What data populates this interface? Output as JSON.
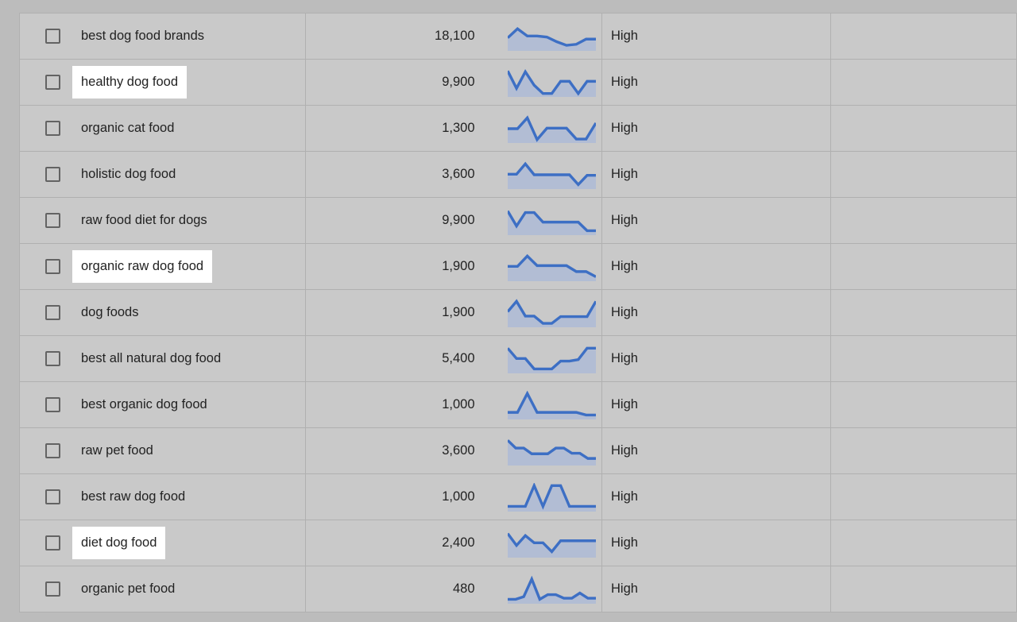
{
  "table": {
    "rows": [
      {
        "keyword": "best dog food brands",
        "highlighted": false,
        "volume": "18,100",
        "competition": "High",
        "sparkline": [
          0.45,
          0.8,
          0.52,
          0.52,
          0.48,
          0.3,
          0.16,
          0.2,
          0.4,
          0.4
        ]
      },
      {
        "keyword": "healthy dog food",
        "highlighted": true,
        "volume": "9,900",
        "competition": "High",
        "sparkline": [
          0.95,
          0.28,
          0.92,
          0.4,
          0.08,
          0.08,
          0.55,
          0.55,
          0.08,
          0.55,
          0.55
        ]
      },
      {
        "keyword": "organic cat food",
        "highlighted": false,
        "volume": "1,300",
        "competition": "High",
        "sparkline": [
          0.5,
          0.5,
          0.92,
          0.08,
          0.52,
          0.52,
          0.52,
          0.1,
          0.1,
          0.72
        ]
      },
      {
        "keyword": "holistic dog food",
        "highlighted": false,
        "volume": "3,600",
        "competition": "High",
        "sparkline": [
          0.52,
          0.52,
          0.92,
          0.5,
          0.5,
          0.5,
          0.5,
          0.5,
          0.12,
          0.48,
          0.48
        ]
      },
      {
        "keyword": "raw food diet for dogs",
        "highlighted": false,
        "volume": "9,900",
        "competition": "High",
        "sparkline": [
          0.88,
          0.3,
          0.82,
          0.82,
          0.45,
          0.45,
          0.45,
          0.45,
          0.45,
          0.12,
          0.12
        ]
      },
      {
        "keyword": "organic raw dog food",
        "highlighted": true,
        "volume": "1,900",
        "competition": "High",
        "sparkline": [
          0.52,
          0.52,
          0.92,
          0.55,
          0.55,
          0.55,
          0.55,
          0.32,
          0.32,
          0.12
        ]
      },
      {
        "keyword": "dog foods",
        "highlighted": false,
        "volume": "1,900",
        "competition": "High",
        "sparkline": [
          0.55,
          0.95,
          0.38,
          0.38,
          0.1,
          0.1,
          0.36,
          0.36,
          0.36,
          0.36,
          0.95
        ]
      },
      {
        "keyword": "best all natural dog food",
        "highlighted": false,
        "volume": "5,400",
        "competition": "High",
        "sparkline": [
          0.92,
          0.52,
          0.52,
          0.12,
          0.12,
          0.12,
          0.42,
          0.42,
          0.48,
          0.92,
          0.92
        ]
      },
      {
        "keyword": "best organic dog food",
        "highlighted": false,
        "volume": "1,000",
        "competition": "High",
        "sparkline": [
          0.22,
          0.22,
          0.95,
          0.22,
          0.22,
          0.22,
          0.22,
          0.22,
          0.12,
          0.12
        ]
      },
      {
        "keyword": "raw pet food",
        "highlighted": false,
        "volume": "3,600",
        "competition": "High",
        "sparkline": [
          0.92,
          0.62,
          0.62,
          0.4,
          0.4,
          0.4,
          0.62,
          0.62,
          0.42,
          0.42,
          0.22,
          0.22
        ]
      },
      {
        "keyword": "best raw dog food",
        "highlighted": false,
        "volume": "1,000",
        "competition": "High",
        "sparkline": [
          0.15,
          0.15,
          0.15,
          0.95,
          0.15,
          0.95,
          0.95,
          0.15,
          0.15,
          0.15,
          0.15
        ]
      },
      {
        "keyword": "diet dog food",
        "highlighted": true,
        "volume": "2,400",
        "competition": "High",
        "sparkline": [
          0.88,
          0.42,
          0.8,
          0.52,
          0.52,
          0.18,
          0.6,
          0.6,
          0.6,
          0.6,
          0.6
        ]
      },
      {
        "keyword": "organic pet food",
        "highlighted": false,
        "volume": "480",
        "competition": "High",
        "sparkline": [
          0.12,
          0.12,
          0.22,
          0.9,
          0.12,
          0.3,
          0.3,
          0.16,
          0.16,
          0.36,
          0.16,
          0.16
        ]
      }
    ]
  },
  "colors": {
    "page_background": "#bcbcbc",
    "row_background": "#c9c9c9",
    "row_border": "#b0b0b0",
    "text": "#222222",
    "highlight_background": "#ffffff",
    "sparkline_line": "#3d6fc4",
    "sparkline_fill": "#b2bdd4",
    "checkbox_border": "#636363"
  }
}
